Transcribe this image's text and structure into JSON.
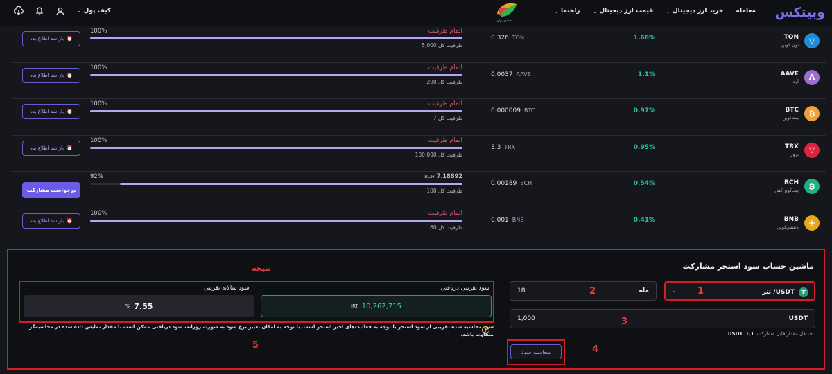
{
  "header": {
    "brand": "وبیتکس",
    "nav": [
      "معامله",
      "خرید ارز دیجیتال",
      "قیمت ارز دیجیتال",
      "راهنما"
    ],
    "wallet_label": "کیف پول",
    "logo_caption": "جشن بهار"
  },
  "rows": [
    {
      "symbol": "TON",
      "name_fa": "تون کوین",
      "apy": "1.66%",
      "min_amount": "0.326",
      "unit": "TON",
      "fill_pct": "100%",
      "fill_value": 1.0,
      "status": "اتمام ظرفیت",
      "total": "ظرفیت کل 5,000",
      "action": "باز شد اطلاع بده",
      "logo_color": "#1e8ed8",
      "logo_glyph": "▽"
    },
    {
      "symbol": "AAVE",
      "name_fa": "آوه",
      "apy": "1.1%",
      "min_amount": "0.0037",
      "unit": "AAVE",
      "fill_pct": "100%",
      "fill_value": 1.0,
      "status": "اتمام ظرفیت",
      "total": "ظرفیت کل 200",
      "action": "باز شد اطلاع بده",
      "logo_color": "#9b6fd0",
      "logo_glyph": "Λ"
    },
    {
      "symbol": "BTC",
      "name_fa": "بیت‌کوین",
      "apy": "0.97%",
      "min_amount": "0.000009",
      "unit": "BTC",
      "fill_pct": "100%",
      "fill_value": 1.0,
      "status": "اتمام ظرفیت",
      "total": "ظرفیت کل 7",
      "action": "باز شد اطلاع بده",
      "logo_color": "#f2a03a",
      "logo_glyph": "₿"
    },
    {
      "symbol": "TRX",
      "name_fa": "ترون",
      "apy": "0.95%",
      "min_amount": "3.3",
      "unit": "TRX",
      "fill_pct": "100%",
      "fill_value": 1.0,
      "status": "اتمام ظرفیت",
      "total": "ظرفیت کل 100,000",
      "action": "باز شد اطلاع بده",
      "logo_color": "#e0233a",
      "logo_glyph": "▽"
    },
    {
      "symbol": "BCH",
      "name_fa": "بیت‌کوین‌کش",
      "apy": "0.54%",
      "min_amount": "0.00189",
      "unit": "BCH",
      "fill_pct": "92%",
      "fill_value": 0.92,
      "status": "",
      "remaining_value": "7.18892",
      "remaining_unit": "BCH",
      "total": "ظرفیت کل 100",
      "action": "درخواست مشارکت",
      "logo_color": "#21b07e",
      "logo_glyph": "₿"
    },
    {
      "symbol": "BNB",
      "name_fa": "بایننس‌کوین",
      "apy": "0.41%",
      "min_amount": "0.001",
      "unit": "BNB",
      "fill_pct": "100%",
      "fill_value": 1.0,
      "status": "اتمام ظرفیت",
      "total": "ظرفیت کل 60",
      "action": "باز شد اطلاع بده",
      "logo_color": "#e9a71c",
      "logo_glyph": "◈"
    }
  ],
  "calculator": {
    "title": "ماشین حساب سود استخر مشارکت",
    "result_title": "نتیجه",
    "asset": "تتر /USDT",
    "months_value": "18",
    "months_unit": "ماه",
    "amount_value": "1,000",
    "amount_unit": "USDT",
    "min_note_label": "حداقل مقدار قابل مشارکت:",
    "min_note_value": "1.1",
    "min_note_unit": "USDT",
    "calc_button": "محاسبه سود",
    "profit_label": "سود تقریبی دریافتی",
    "profit_value": "10,262,715",
    "profit_unit": "IRT",
    "annual_label": "سود سالانه تقریبی",
    "annual_value": "7.55",
    "annual_unit": "%",
    "info_text": "سود محاسبه شده تقریبی از سود استخر با توجه به فعالیت‌های اخیر استخر است. با توجه به امکان تغییر نرخ سود به صورت روزانه، سود دریافتی ممکن است با مقدار نمایش داده شده در محاسبه‌گر متفاوت باشد.",
    "markers": [
      "1",
      "2",
      "3",
      "4",
      "5"
    ]
  },
  "colors": {
    "accent": "#6b5ce7",
    "positive": "#23c49b",
    "danger": "#e1566a",
    "highlight": "#d71d24"
  }
}
